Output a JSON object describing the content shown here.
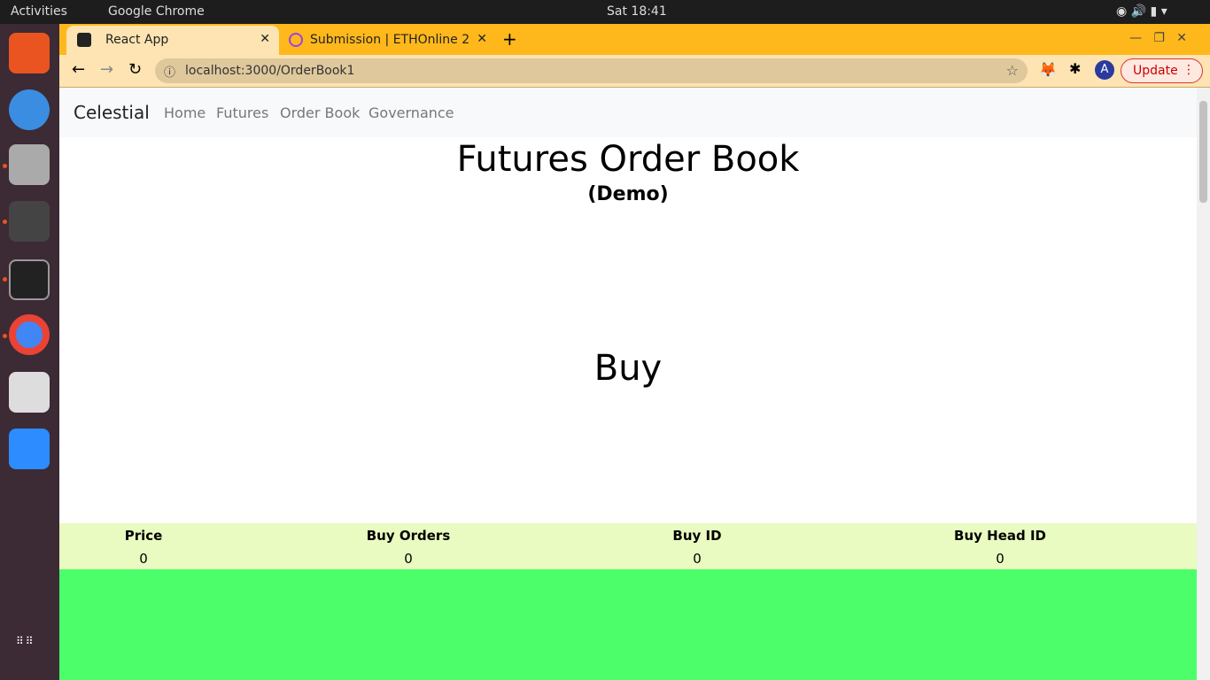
{
  "system": {
    "activities": "Activities",
    "app": "Google Chrome",
    "clock": "Sat 18:41"
  },
  "browser": {
    "tabs": [
      {
        "label": "React App",
        "active": true
      },
      {
        "label": "Submission | ETHOnline 2",
        "active": false
      }
    ],
    "url": "localhost:3000/OrderBook1",
    "update_label": "Update",
    "profile_initial": "A"
  },
  "navbar": {
    "brand": "Celestial",
    "links": [
      "Home",
      "Futures",
      "Order Book",
      "Governance"
    ]
  },
  "page": {
    "title": "Futures Order Book",
    "subtitle": "(Demo)",
    "section": "Buy"
  },
  "table": {
    "headers": [
      "Price",
      "Buy Orders",
      "Buy ID",
      "Buy Head ID"
    ],
    "row": [
      "0",
      "0",
      "0",
      "0"
    ]
  },
  "colors": {
    "chrome": "#ffb81c",
    "table_bg": "#e9fbc0",
    "green": "#4cff6a"
  }
}
